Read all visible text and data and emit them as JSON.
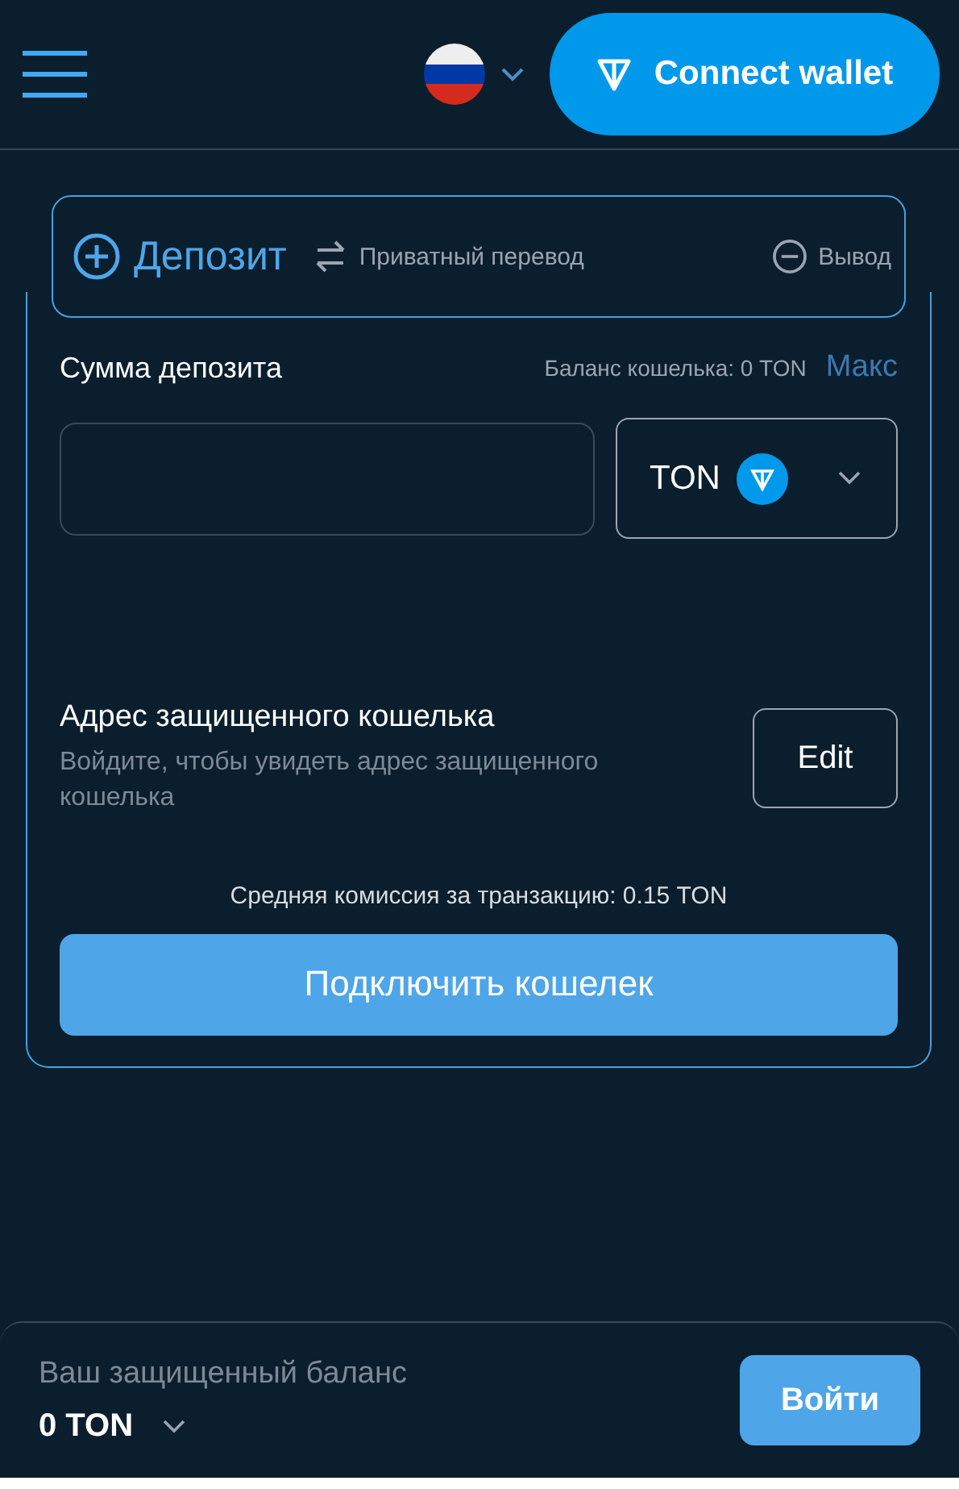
{
  "header": {
    "connect_button": "Connect wallet"
  },
  "tabs": [
    {
      "label": "Депозит",
      "kind": "plus",
      "selected": true
    },
    {
      "label": "Приватный перевод",
      "kind": "swap",
      "selected": false
    },
    {
      "label": "Вывод",
      "kind": "minus",
      "selected": false
    }
  ],
  "deposit": {
    "label": "Сумма депозита",
    "balance": "Баланс кошелька: 0 TON",
    "max_link": "Макс",
    "token": "TON"
  },
  "address": {
    "title": "Адрес защищенного кошелька",
    "hint": "Войдите, чтобы увидеть адрес защищенного кошелька",
    "edit_button": "Edit"
  },
  "fee": "Средняя комиссия за транзакцию: 0.15 TON",
  "connect_button": "Подключить кошелек",
  "footer": {
    "label": "Ваш защищенный баланс",
    "amount": "0 TON",
    "login_button": "Войти"
  }
}
